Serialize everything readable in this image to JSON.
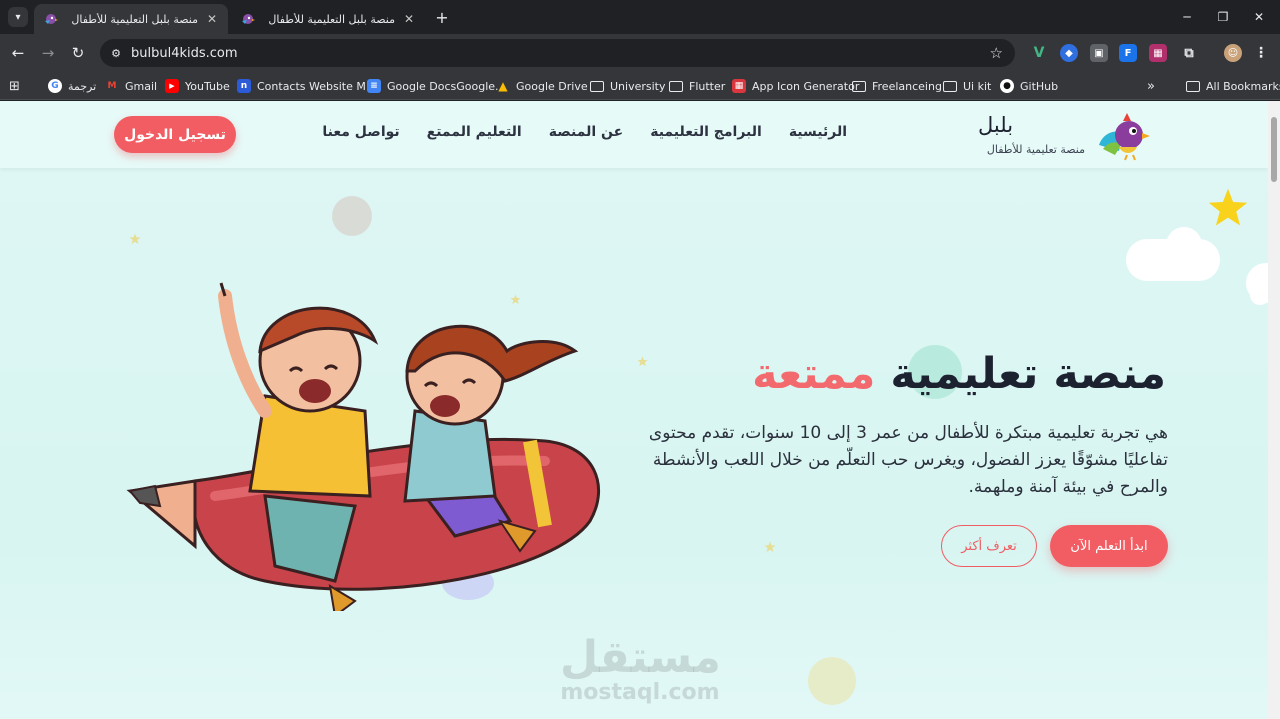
{
  "browser": {
    "tabs": [
      {
        "title": "منصة بلبل التعليمية للأطفال",
        "active": true
      },
      {
        "title": "منصة بلبل التعليمية للأطفال",
        "active": false
      }
    ],
    "new_tab_label": "+",
    "url": "bulbul4kids.com",
    "bookmarks": [
      {
        "label": "ترجمة",
        "icon": "google-icon"
      },
      {
        "label": "Gmail",
        "icon": "gmail-icon"
      },
      {
        "label": "YouTube",
        "icon": "youtube-icon"
      },
      {
        "label": "Contacts Website M...",
        "icon": "contacts-icon"
      },
      {
        "label": "Google DocsGoogle...",
        "icon": "docs-icon"
      },
      {
        "label": "Google Drive",
        "icon": "drive-icon"
      },
      {
        "label": "University",
        "icon": "folder-icon"
      },
      {
        "label": "Flutter",
        "icon": "folder-icon"
      },
      {
        "label": "App Icon Generator",
        "icon": "app-icon-generator-icon"
      },
      {
        "label": "Freelanceing",
        "icon": "folder-icon"
      },
      {
        "label": "Ui kit",
        "icon": "folder-icon"
      },
      {
        "label": "GitHub",
        "icon": "github-icon"
      }
    ],
    "all_bookmarks_label": "All Bookmarks"
  },
  "site": {
    "logo": {
      "name": "بلبل",
      "tagline": "منصة تعليمية للأطفال"
    },
    "nav": [
      "الرئيسية",
      "البرامج التعليمية",
      "عن المنصة",
      "التعليم الممتع",
      "تواصل معنا"
    ],
    "login_label": "تسجيل الدخول",
    "hero": {
      "title_main": "منصة تعليمية",
      "title_accent": "ممتعة",
      "description": "هي تجربة تعليمية مبتكرة للأطفال من عمر 3 إلى 10 سنوات، تقدم محتوى تفاعليًا مشوّقًا يعزز الفضول، ويغرس حب التعلّم من خلال اللعب والأنشطة والمرح في بيئة آمنة وملهمة.",
      "cta_primary": "ابدأ التعلم الآن",
      "cta_secondary": "تعرف أكثر"
    },
    "watermark": {
      "arabic": "مستقل",
      "latin": "mostaql.com"
    }
  },
  "colors": {
    "accent": "#f15d62",
    "background": "#dff7f4",
    "heading": "#1d2230"
  }
}
